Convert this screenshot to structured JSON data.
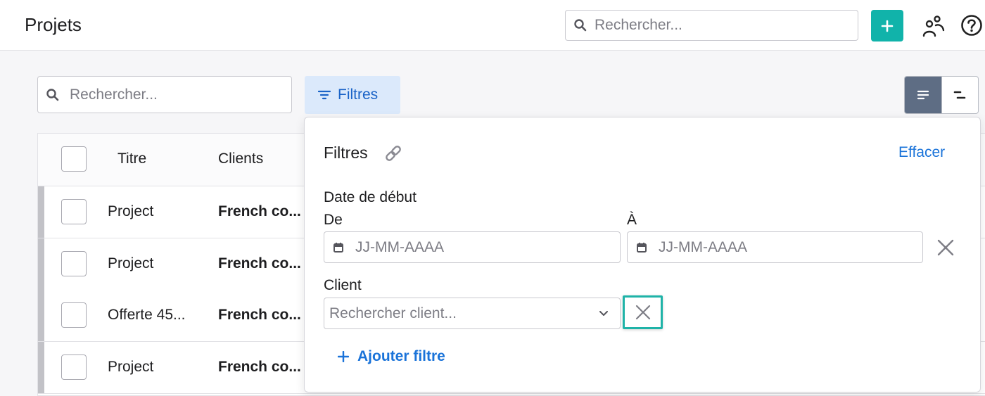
{
  "header": {
    "title": "Projets",
    "search_placeholder": "Rechercher...",
    "add_button_label": "+"
  },
  "toolbar": {
    "search_placeholder": "Rechercher...",
    "filters_label": "Filtres"
  },
  "table": {
    "columns": [
      "Titre",
      "Clients"
    ],
    "rows": [
      {
        "title": "Project",
        "client": "French co..."
      },
      {
        "title": "Project",
        "client": "French co..."
      },
      {
        "title": "Offerte 45...",
        "client": "French co..."
      },
      {
        "title": "Project",
        "client": "French co..."
      }
    ]
  },
  "filters_panel": {
    "title": "Filtres",
    "clear_label": "Effacer",
    "date_section_label": "Date de début",
    "from_label": "De",
    "to_label": "À",
    "from_placeholder": "JJ-MM-AAAA",
    "to_placeholder": "JJ-MM-AAAA",
    "client_label": "Client",
    "client_placeholder": "Rechercher client...",
    "add_filter_label": "Ajouter filtre"
  },
  "colors": {
    "accent_teal": "#11b3aa",
    "link_blue": "#1a73d9",
    "filter_button_bg": "#dbe9fb",
    "highlight_border": "#1fb3a8",
    "active_view": "#5e6d84"
  },
  "icons": {
    "search": "search-icon",
    "plus": "plus-icon",
    "people": "people-icon",
    "help": "help-icon",
    "filter": "filter-icon",
    "list_view": "list-view-icon",
    "gantt_view": "gantt-view-icon",
    "link": "link-icon",
    "calendar": "calendar-icon",
    "close": "close-icon",
    "chevron_down": "chevron-down-icon"
  }
}
